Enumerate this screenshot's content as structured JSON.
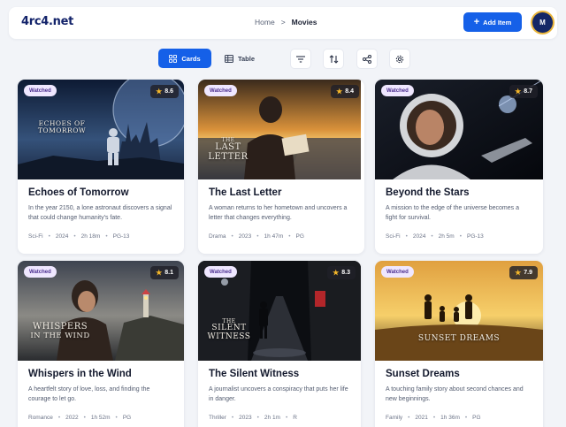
{
  "header": {
    "logo": "4rc4.net",
    "breadcrumb": {
      "home": "Home",
      "separator": ">",
      "current": "Movies"
    },
    "add_button": "Add Item",
    "avatar_initial": "M"
  },
  "toolbar": {
    "views": [
      {
        "label": "Cards",
        "icon": "grid-icon",
        "active": true
      },
      {
        "label": "Table",
        "icon": "table-icon",
        "active": false
      }
    ],
    "actions": [
      "filter-icon",
      "sort-icon",
      "share-icon",
      "settings-icon"
    ]
  },
  "colors": {
    "accent": "#1560e8",
    "watched_bg": "#efe7ff",
    "star": "#f5b72a"
  },
  "movies": [
    {
      "title": "Echoes of Tomorrow",
      "poster_title": "ECHOES OF TOMORROW",
      "poster_lines": [
        "ECHOES OF",
        "TOMORROW"
      ],
      "watched": "Watched",
      "rating": "8.6",
      "description": "In the year 2150, a lone astronaut discovers a signal that could change humanity's fate.",
      "genre": "Sci-Fi",
      "year": "2024",
      "duration": "2h 18m",
      "certificate": "PG-13"
    },
    {
      "title": "The Last Letter",
      "poster_title": "THE LAST LETTER",
      "poster_lines": [
        "THE",
        "LAST",
        "LETTER"
      ],
      "watched": "Watched",
      "rating": "8.4",
      "description": "A woman returns to her hometown and uncovers a letter that changes everything.",
      "genre": "Drama",
      "year": "2023",
      "duration": "1h 47m",
      "certificate": "PG"
    },
    {
      "title": "Beyond the Stars",
      "poster_title": "",
      "watched": "Watched",
      "rating": "8.7",
      "description": "A mission to the edge of the universe becomes a fight for survival.",
      "genre": "Sci-Fi",
      "year": "2024",
      "duration": "2h 5m",
      "certificate": "PG-13"
    },
    {
      "title": "Whispers in the Wind",
      "poster_title": "WHISPERS IN THE WIND",
      "poster_lines": [
        "WHISPERS",
        "IN THE WIND"
      ],
      "watched": "Watched",
      "rating": "8.1",
      "description": "A heartfelt story of love, loss, and finding the courage to let go.",
      "genre": "Romance",
      "year": "2022",
      "duration": "1h 52m",
      "certificate": "PG"
    },
    {
      "title": "The Silent Witness",
      "poster_title": "THE SILENT WITNESS",
      "poster_lines": [
        "THE",
        "SILENT",
        "WITNESS"
      ],
      "watched": "Watched",
      "rating": "8.3",
      "description": "A journalist uncovers a conspiracy that puts her life in danger.",
      "genre": "Thriller",
      "year": "2023",
      "duration": "2h 1m",
      "certificate": "R"
    },
    {
      "title": "Sunset Dreams",
      "poster_title": "SUNSET DREAMS",
      "poster_lines": [
        "SUNSET DREAMS"
      ],
      "watched": "Watched",
      "rating": "7.9",
      "description": "A touching family story about second chances and new beginnings.",
      "genre": "Family",
      "year": "2021",
      "duration": "1h 36m",
      "certificate": "PG"
    }
  ]
}
